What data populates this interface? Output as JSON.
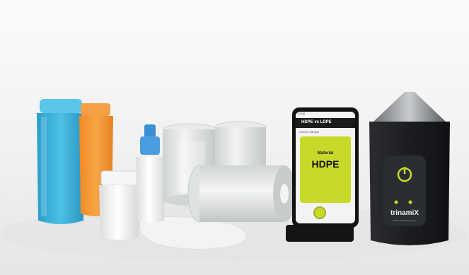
{
  "phone": {
    "status_time": "12:00",
    "app_title": "HDPE vs LDPE",
    "section_label": "Current Sample",
    "result_caption": "Material",
    "result_value": "HDPE",
    "accent_color": "#c8d92a"
  },
  "device": {
    "brand": "trinamiX",
    "sub_label": "Mobile NIR Spectroscopy",
    "power_icon": "power-icon",
    "status_icons": [
      "battery-icon",
      "signal-icon"
    ]
  },
  "colors": {
    "blue_bottle": "#3fb6dc",
    "orange_bottle": "#f3922f",
    "device_body": "#1f2124",
    "device_accent": "#c8d92a",
    "background": "#f4f4f4"
  }
}
